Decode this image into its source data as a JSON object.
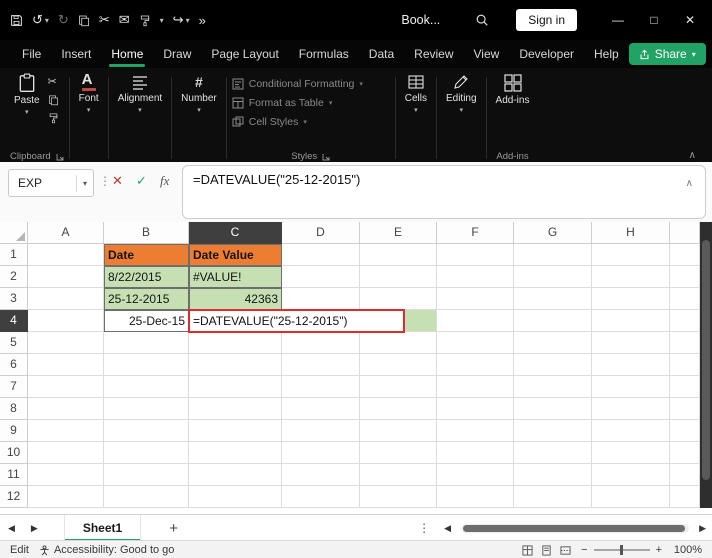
{
  "colors": {
    "accent_green": "#21A366",
    "table_header_fill": "#ED7D31",
    "table_cell_fill": "#C6E0B4",
    "editor_border": "#E02B2B"
  },
  "window": {
    "document_name": "Book...",
    "sign_in_label": "Sign in",
    "overflow_glyph": "»"
  },
  "ribbon": {
    "tabs": [
      "File",
      "Insert",
      "Home",
      "Draw",
      "Page Layout",
      "Formulas",
      "Data",
      "Review",
      "View",
      "Developer",
      "Help"
    ],
    "active_tab": "Home",
    "share_label": "Share",
    "paste_label": "Paste",
    "clipboard_group_label": "Clipboard",
    "font_label": "Font",
    "alignment_label": "Alignment",
    "number_label": "Number",
    "conditional_formatting_label": "Conditional Formatting",
    "format_as_table_label": "Format as Table",
    "cell_styles_label": "Cell Styles",
    "styles_group_label": "Styles",
    "cells_label": "Cells",
    "editing_label": "Editing",
    "addins_label": "Add-ins",
    "addins_group_label": "Add-ins"
  },
  "formula_bar": {
    "name_box_value": "EXP",
    "formula": "=DATEVALUE(\"25-12-2015\")"
  },
  "grid": {
    "column_headers": [
      "A",
      "B",
      "C",
      "D",
      "E",
      "F",
      "G",
      "H"
    ],
    "row_headers": [
      "1",
      "2",
      "3",
      "4",
      "5",
      "6",
      "7",
      "8",
      "9",
      "10",
      "11",
      "12"
    ],
    "selected_column": "C",
    "selected_row": "4",
    "cells": {
      "B1": {
        "text": "Date",
        "bg": "#ED7D31",
        "bold": true,
        "align": "left",
        "bordered": true
      },
      "C1": {
        "text": "Date Value",
        "bg": "#ED7D31",
        "bold": true,
        "align": "left",
        "bordered": true
      },
      "B2": {
        "text": "8/22/2015",
        "bg": "#C6E0B4",
        "align": "left",
        "bordered": true
      },
      "C2": {
        "text": "#VALUE!",
        "bg": "#C6E0B4",
        "align": "left",
        "bordered": true
      },
      "B3": {
        "text": "25-12-2015",
        "bg": "#C6E0B4",
        "align": "left",
        "bordered": true
      },
      "C3": {
        "text": "42363",
        "bg": "#C6E0B4",
        "align": "right",
        "bordered": true
      },
      "B4": {
        "text": "25-Dec-15",
        "align": "right",
        "bordered": true
      },
      "E4": {
        "bg": "#C6E0B4"
      }
    },
    "editor": {
      "cell": "C4",
      "text": "=DATEVALUE(\"25-12-2015\")"
    }
  },
  "sheet_bar": {
    "tabs": [
      {
        "label": "Sheet1",
        "active": true
      }
    ],
    "add_sheet_glyph": "+"
  },
  "status_bar": {
    "mode": "Edit",
    "accessibility_text": "Accessibility: Good to go",
    "zoom_percent": "100%"
  },
  "icons": {
    "undo": "↺",
    "redo": "↻",
    "redo_arrow": "↪",
    "cut": "✂",
    "mail": "✉",
    "caret_down": "▾",
    "check": "✓",
    "cancel": "✕",
    "fx": "fx",
    "dots_vertical": "⋮",
    "collapse": "∧",
    "nav_left": "◀",
    "nav_right": "▶",
    "minimize": "—",
    "maximize": "□",
    "close": "✕",
    "minus": "−",
    "plus": "+"
  }
}
